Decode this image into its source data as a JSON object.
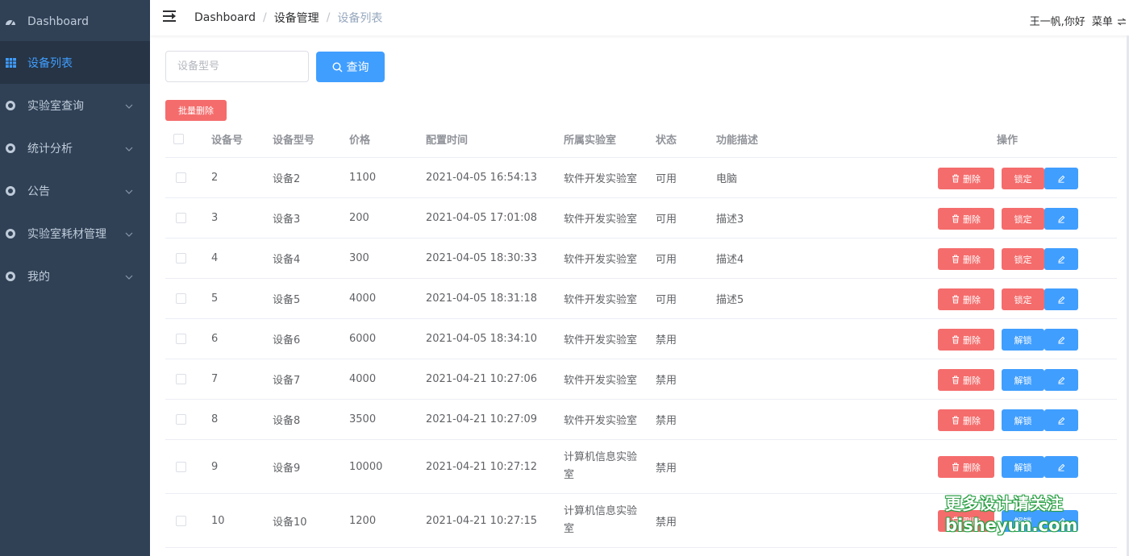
{
  "sidebar": {
    "items": [
      {
        "label": "Dashboard",
        "icon": "dashboard-icon",
        "active": false,
        "has_children": false
      },
      {
        "label": "设备列表",
        "icon": "grid-icon",
        "active": true,
        "has_children": false
      },
      {
        "label": "实验室查询",
        "icon": "ring-icon",
        "active": false,
        "has_children": true
      },
      {
        "label": "统计分析",
        "icon": "ring-icon",
        "active": false,
        "has_children": true
      },
      {
        "label": "公告",
        "icon": "ring-icon",
        "active": false,
        "has_children": true
      },
      {
        "label": "实验室耗材管理",
        "icon": "ring-icon",
        "active": false,
        "has_children": true
      },
      {
        "label": "我的",
        "icon": "ring-icon",
        "active": false,
        "has_children": true
      }
    ]
  },
  "header": {
    "breadcrumb": [
      "Dashboard",
      "设备管理",
      "设备列表"
    ],
    "breadcrumb_sep": "/",
    "user_greeting": "王一帆,你好",
    "menu_label": "菜单"
  },
  "toolbar": {
    "search_placeholder": "设备型号",
    "search_value": "",
    "query_label": "查询",
    "batch_delete_label": "批量删除"
  },
  "table": {
    "columns": [
      "设备号",
      "设备型号",
      "价格",
      "配置时间",
      "所属实验室",
      "状态",
      "功能描述",
      "操作"
    ],
    "rows": [
      {
        "id": "2",
        "model": "设备2",
        "price": "1100",
        "time": "2021-04-05 16:54:13",
        "lab": "软件开发实验室",
        "status": "可用",
        "desc": "电脑",
        "action": "锁定"
      },
      {
        "id": "3",
        "model": "设备3",
        "price": "200",
        "time": "2021-04-05 17:01:08",
        "lab": "软件开发实验室",
        "status": "可用",
        "desc": "描述3",
        "action": "锁定"
      },
      {
        "id": "4",
        "model": "设备4",
        "price": "300",
        "time": "2021-04-05 18:30:33",
        "lab": "软件开发实验室",
        "status": "可用",
        "desc": "描述4",
        "action": "锁定"
      },
      {
        "id": "5",
        "model": "设备5",
        "price": "4000",
        "time": "2021-04-05 18:31:18",
        "lab": "软件开发实验室",
        "status": "可用",
        "desc": "描述5",
        "action": "锁定"
      },
      {
        "id": "6",
        "model": "设备6",
        "price": "6000",
        "time": "2021-04-05 18:34:10",
        "lab": "软件开发实验室",
        "status": "禁用",
        "desc": "",
        "action": "解锁"
      },
      {
        "id": "7",
        "model": "设备7",
        "price": "4000",
        "time": "2021-04-21 10:27:06",
        "lab": "软件开发实验室",
        "status": "禁用",
        "desc": "",
        "action": "解锁"
      },
      {
        "id": "8",
        "model": "设备8",
        "price": "3500",
        "time": "2021-04-21 10:27:09",
        "lab": "软件开发实验室",
        "status": "禁用",
        "desc": "",
        "action": "解锁"
      },
      {
        "id": "9",
        "model": "设备9",
        "price": "10000",
        "time": "2021-04-21 10:27:12",
        "lab": "计算机信息实验室",
        "status": "禁用",
        "desc": "",
        "action": "解锁"
      },
      {
        "id": "10",
        "model": "设备10",
        "price": "1200",
        "time": "2021-04-21 10:27:15",
        "lab": "计算机信息实验室",
        "status": "禁用",
        "desc": "",
        "action": "解锁"
      }
    ],
    "delete_label": "删除",
    "edit_icon": "pencil-icon"
  },
  "watermark": {
    "line1": "更多设计请关注",
    "line2": "bisheyun.com"
  },
  "colors": {
    "sidebar_bg": "#304156",
    "primary": "#409eff",
    "danger": "#f56c6c"
  }
}
